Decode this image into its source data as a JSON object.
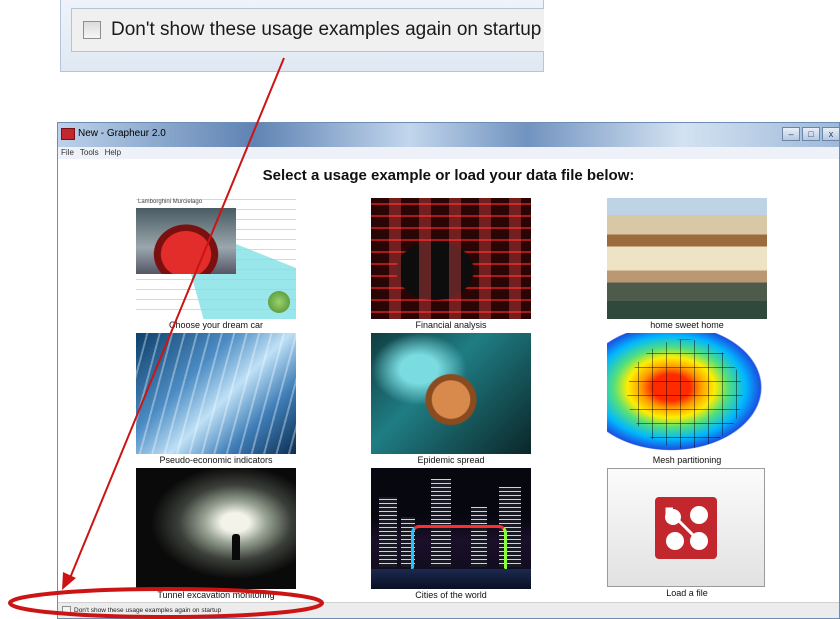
{
  "callout": {
    "checkbox_label": "Don't show these usage examples again on startup",
    "checked": false
  },
  "window": {
    "title": "New - Grapheur 2.0",
    "controls": [
      "–",
      "□",
      "x"
    ],
    "menu": [
      "File",
      "Tools",
      "Help"
    ],
    "heading": "Select a usage example or load your data file below:",
    "car_photo_tag": "Lamborghini Murcielago"
  },
  "tiles": [
    {
      "caption": "Choose your dream car",
      "icon": "car-photo"
    },
    {
      "caption": "Financial analysis",
      "icon": "stock-board-photo"
    },
    {
      "caption": "home sweet home",
      "icon": "houses-photo"
    },
    {
      "caption": "Pseudo-economic indicators",
      "icon": "glass-building-photo"
    },
    {
      "caption": "Epidemic spread",
      "icon": "virus-photo"
    },
    {
      "caption": "Mesh partitioning",
      "icon": "mesh-heatmap"
    },
    {
      "caption": "Tunnel excavation monitoring",
      "icon": "tunnel-photo"
    },
    {
      "caption": "Cities of the world",
      "icon": "city-night-photo"
    },
    {
      "caption": "Load a file",
      "icon": "load-file-icon"
    }
  ],
  "statusbar": {
    "checkbox_label": "Don't show these usage examples again on startup",
    "checked": false
  },
  "colors": {
    "annotation": "#cc1414",
    "titlebar": "#5f83b3",
    "load_icon": "#c1272d"
  }
}
